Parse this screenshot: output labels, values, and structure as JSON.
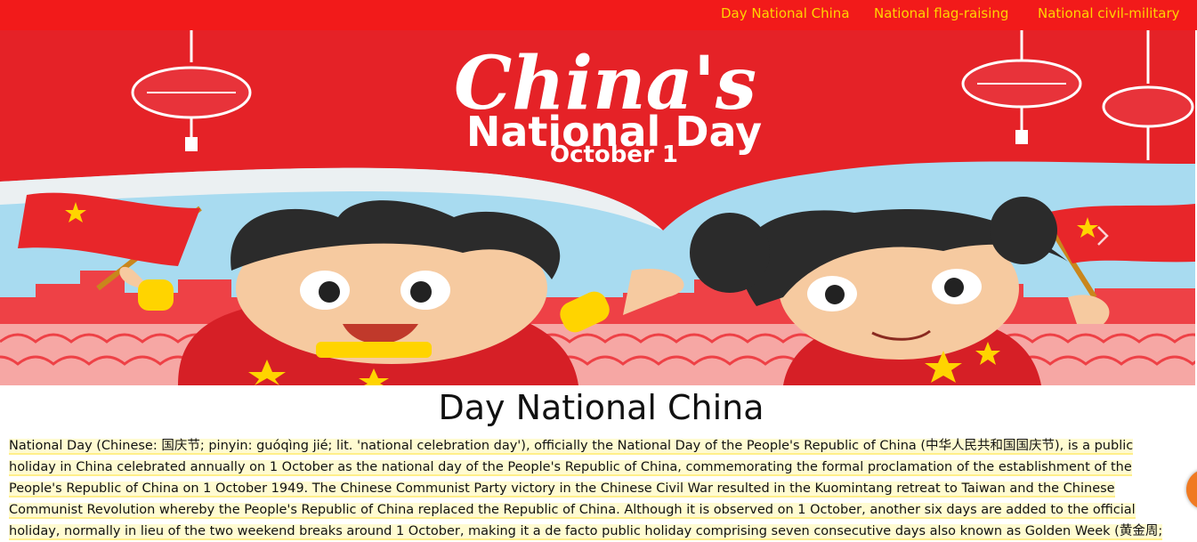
{
  "nav": {
    "links": [
      {
        "label": "Day National China"
      },
      {
        "label": "National flag-raising"
      },
      {
        "label": "National civil-military"
      }
    ]
  },
  "hero": {
    "banner_title": "China's",
    "banner_subtitle": "National Day",
    "banner_date": "October 1",
    "next_glyph": "›"
  },
  "article": {
    "title": "Day National China",
    "body": "National Day (Chinese: 国庆节; pinyin: guóqìng jié; lit. 'national celebration day'), officially the National Day of the People's Republic of China (中华人民共和国国庆节), is a public holiday in China celebrated annually on 1 October as the national day of the People's Republic of China, commemorating the formal proclamation of the establishment of the People's Republic of China on 1 October 1949. The Chinese Communist Party victory in the Chinese Civil War resulted in the Kuomintang retreat to Taiwan and the Chinese Communist Revolution whereby the People's Republic of China replaced the Republic of China. Although it is observed on 1 October, another six days are added to the official holiday, normally in lieu of the two weekend breaks around 1 October, making it a de facto public holiday comprising seven consecutive days also known as Golden Week (黄金周;"
  },
  "colors": {
    "nav_bg": "#f21a1a",
    "nav_text": "#ffd400",
    "banner_red": "#e52227",
    "sky": "#9fd6ee",
    "highlight": "#fffbd1"
  }
}
